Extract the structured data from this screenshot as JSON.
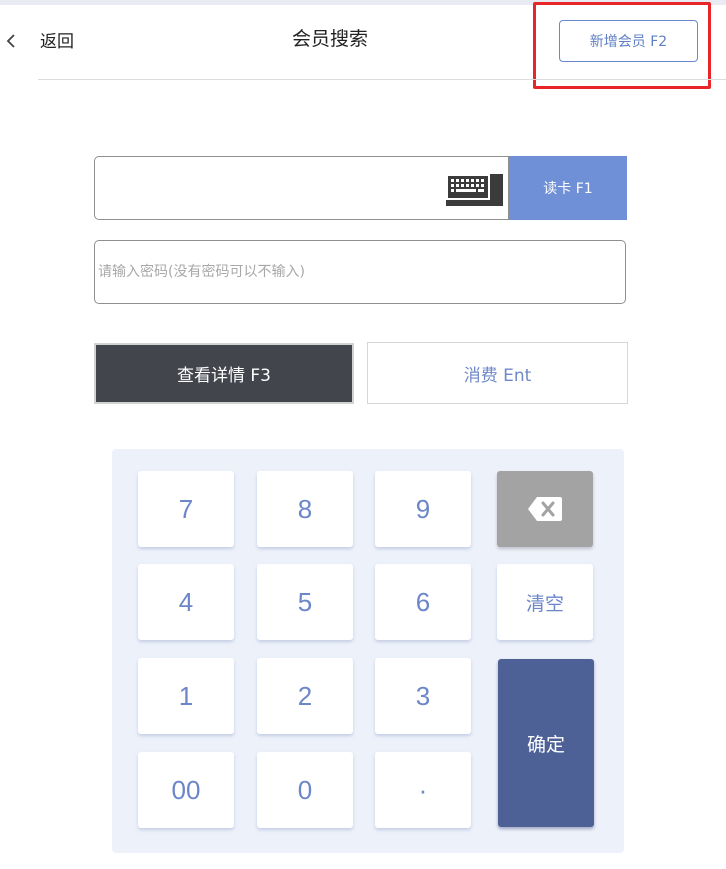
{
  "header": {
    "back_label": "返回",
    "title": "会员搜索",
    "new_member_label": "新增会员 F2"
  },
  "search": {
    "card_value": "",
    "read_card_label": "读卡 F1",
    "password_placeholder": "请输入密码(没有密码可以不输入)"
  },
  "actions": {
    "details_label": "查看详情 F3",
    "consume_label": "消费 Ent"
  },
  "keypad": {
    "keys": [
      "7",
      "8",
      "9",
      "4",
      "5",
      "6",
      "1",
      "2",
      "3",
      "00",
      "0",
      "·"
    ],
    "clear_label": "清空",
    "confirm_label": "确定",
    "backspace_icon": "backspace-icon"
  },
  "colors": {
    "accent": "#6f8fd6",
    "confirm": "#4d6196",
    "details_bg": "#43454d",
    "highlight": "#e8262a"
  }
}
